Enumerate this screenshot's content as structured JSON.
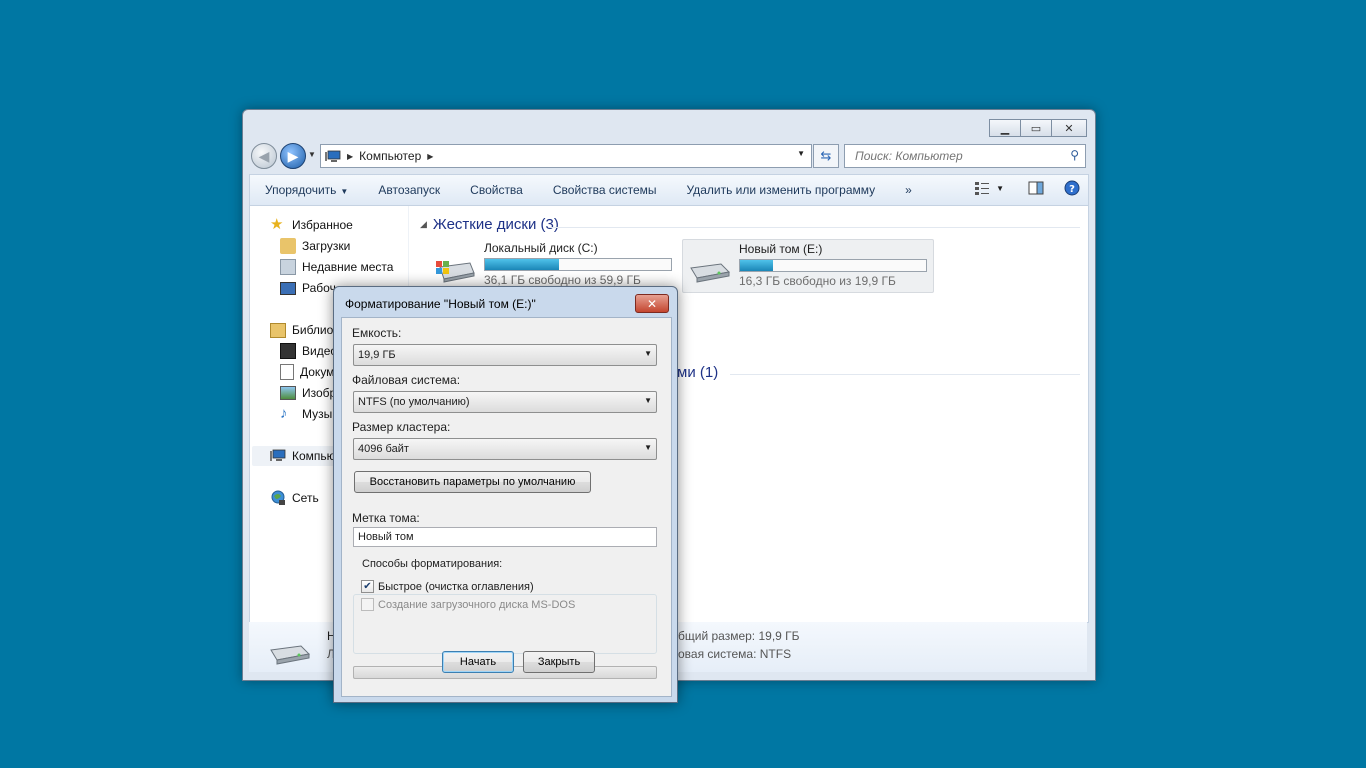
{
  "explorer": {
    "nav": {
      "back_label": "◀",
      "forward_label": "▶"
    },
    "address": {
      "location": "Компьютер"
    },
    "search": {
      "placeholder": "Поиск: Компьютер"
    },
    "toolbar": {
      "organize": "Упорядочить",
      "autoplay": "Автозапуск",
      "properties": "Свойства",
      "system_properties": "Свойства системы",
      "uninstall": "Удалить или изменить программу",
      "more": "»"
    },
    "sidebar": {
      "favorites": "Избранное",
      "downloads": "Загрузки",
      "recent": "Недавние места",
      "desktop": "Рабоч",
      "libraries": "Библио",
      "videos": "Видео",
      "documents": "Докум",
      "pictures": "Изобр",
      "music": "Музы",
      "computer": "Компью",
      "network": "Сеть"
    },
    "hard_disks_group": "Жесткие диски (3)",
    "other_group_partial": "ми (1)",
    "drives": [
      {
        "name": "Локальный диск (C:)",
        "free": "36,1 ГБ свободно из 59,9 ГБ",
        "used_fraction": 0.4
      },
      {
        "name": "Новый том (E:)",
        "free": "16,3 ГБ свободно из 19,9 ГБ",
        "used_fraction": 0.18
      }
    ],
    "details": {
      "name_partial": "Н",
      "type_partial": "Л",
      "total_size": "бщий размер: 19,9 ГБ",
      "filesystem": "овая система: NTFS"
    }
  },
  "format_dialog": {
    "title": "Форматирование \"Новый том (E:)\"",
    "capacity_label": "Емкость:",
    "capacity_value": "19,9 ГБ",
    "filesystem_label": "Файловая система:",
    "filesystem_value": "NTFS (по умолчанию)",
    "cluster_label": "Размер кластера:",
    "cluster_value": "4096 байт",
    "restore_defaults": "Восстановить параметры по умолчанию",
    "volume_label_label": "Метка тома:",
    "volume_label_value": "Новый том",
    "format_options_label": "Способы форматирования:",
    "quick_format": "Быстрое (очистка оглавления)",
    "quick_format_checked": true,
    "msdos_disk": "Создание загрузочного диска MS-DOS",
    "msdos_disk_checked": false,
    "progress": 0,
    "start": "Начать",
    "close": "Закрыть"
  }
}
